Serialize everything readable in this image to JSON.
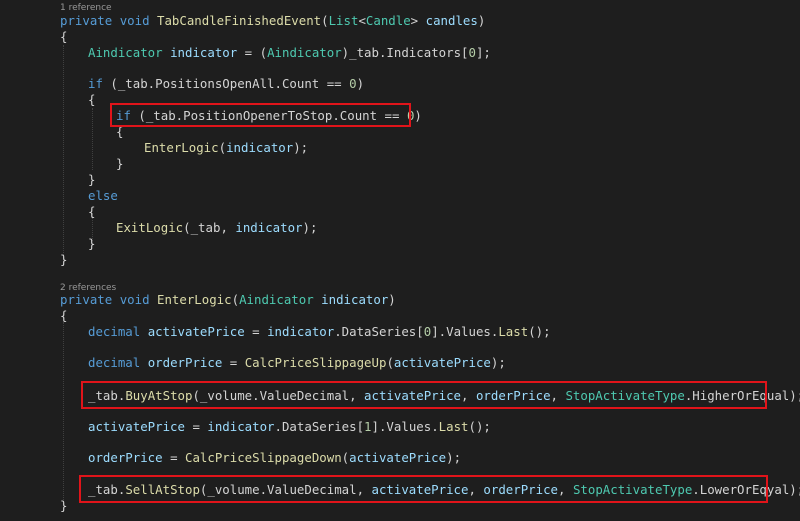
{
  "hints": {
    "ref1": "1 reference",
    "ref2": "2 references"
  },
  "code": {
    "m1": {
      "private": "private",
      "void": "void",
      "name": "TabCandleFinishedEvent",
      "open": "(",
      "list": "List",
      "lt": "<",
      "candle": "Candle",
      "gt": ">",
      "param": "candles",
      "close": ")"
    },
    "brace_open": "{",
    "brace_close": "}",
    "l_ind": {
      "type": "Aindicator",
      "var": "indicator",
      "eq": " = (",
      "type2": "Aindicator",
      "rest": ")_tab.Indicators[",
      "zero": "0",
      "end": "];"
    },
    "l_if1": {
      "kw": "if",
      "pre": " (_tab.PositionsOpenAll.Count == ",
      "zero": "0",
      "end": ")"
    },
    "l_if2": {
      "kw": "if",
      "pre": " (_tab.PositionOpenerToStop.Count == ",
      "zero": "0",
      "end": ")"
    },
    "l_enter_call": {
      "fn": "EnterLogic",
      "open": "(",
      "arg": "indicator",
      "end": ");"
    },
    "else": "else",
    "l_exit_call": {
      "fn": "ExitLogic",
      "open": "(_tab, ",
      "arg": "indicator",
      "end": ");"
    },
    "m2": {
      "private": "private",
      "void": "void",
      "name": "EnterLogic",
      "open": "(",
      "type": "Aindicator",
      "param": "indicator",
      "close": ")"
    },
    "l_act1": {
      "type": "decimal",
      "var": "activatePrice",
      "eq": " = ",
      "ind": "indicator",
      "mid": ".DataSeries[",
      "num": "0",
      "tail": "].Values.",
      "fn": "Last",
      "end": "();"
    },
    "l_ord1": {
      "type": "decimal",
      "var": "orderPrice",
      "eq": " = ",
      "fn": "CalcPriceSlippageUp",
      "open": "(",
      "arg": "activatePrice",
      "end": ");"
    },
    "l_buy": {
      "pre": "_tab.",
      "fn": "BuyAtStop",
      "open": "(_volume.ValueDecimal, ",
      "a1": "activatePrice",
      "c1": ", ",
      "a2": "orderPrice",
      "c2": ", ",
      "ty": "StopActivateType",
      "tail": ".HigherOrEqual);"
    },
    "l_act2": {
      "var": "activatePrice",
      "eq": " = ",
      "ind": "indicator",
      "mid": ".DataSeries[",
      "num": "1",
      "tail": "].Values.",
      "fn": "Last",
      "end": "();"
    },
    "l_ord2": {
      "var": "orderPrice",
      "eq": " = ",
      "fn": "CalcPriceSlippageDown",
      "open": "(",
      "arg": "activatePrice",
      "end": ");"
    },
    "l_sell": {
      "pre": "_tab.",
      "fn": "SellAtStop",
      "open": "(_volume.ValueDecimal, ",
      "a1": "activatePrice",
      "c1": ", ",
      "a2": "orderPrice",
      "c2": ", ",
      "ty": "StopActivateType",
      "tail": ".LowerOrEqyal);"
    }
  }
}
